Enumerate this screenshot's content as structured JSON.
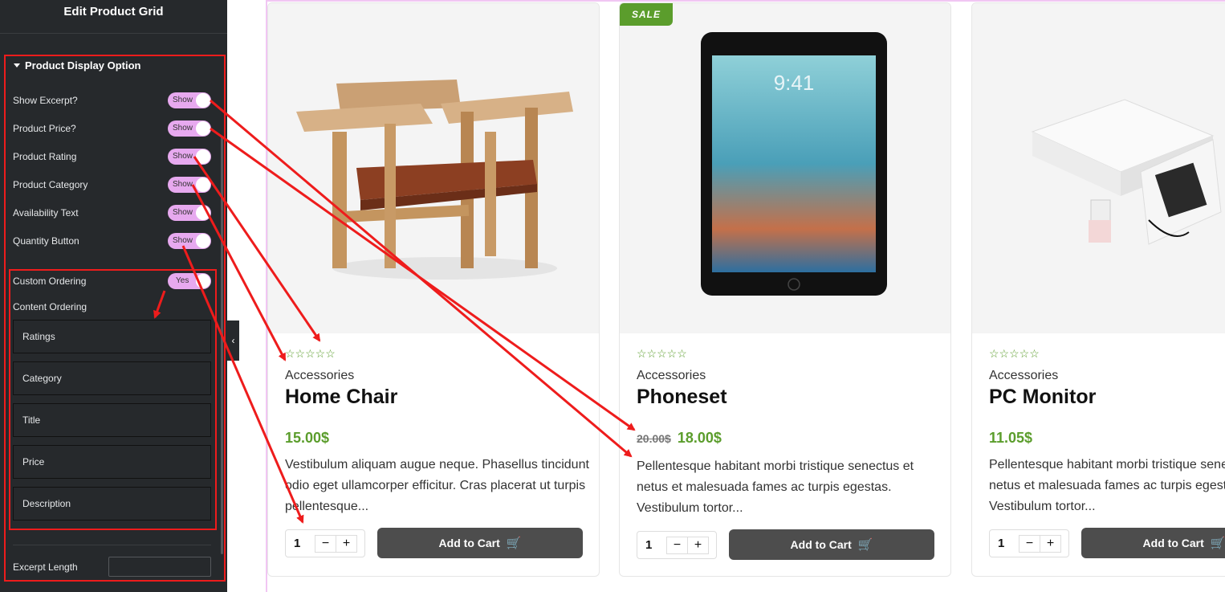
{
  "panel": {
    "title": "Edit Product Grid",
    "section_title": "Product Display Option",
    "options": [
      {
        "label": "Show Excerpt?",
        "toggle": "Show"
      },
      {
        "label": "Product Price?",
        "toggle": "Show"
      },
      {
        "label": "Product Rating",
        "toggle": "Show"
      },
      {
        "label": "Product Category",
        "toggle": "Show"
      },
      {
        "label": "Availability Text",
        "toggle": "Show"
      },
      {
        "label": "Quantity Button",
        "toggle": "Show"
      }
    ],
    "custom_ordering": {
      "label": "Custom Ordering",
      "toggle": "Yes"
    },
    "content_ordering_label": "Content Ordering",
    "ordering_items": [
      "Ratings",
      "Category",
      "Title",
      "Price",
      "Description"
    ],
    "excerpt_length_label": "Excerpt Length",
    "accent_color": "#e7a9ef"
  },
  "products": [
    {
      "category": "Accessories",
      "title": "Home Chair",
      "price": "15.00$",
      "description": "Vestibulum aliquam augue neque. Phasellus tincidunt odio eget ullamcorper efficitur. Cras placerat ut turpis pellentesque...",
      "quantity": "1",
      "cart_label": "Add to Cart"
    },
    {
      "badge": "SALE",
      "category": "Accessories",
      "title": "Phoneset",
      "old_price": "20.00$",
      "price": "18.00$",
      "description": "Pellentesque habitant morbi tristique senectus et netus et malesuada fames ac turpis egestas. Vestibulum tortor...",
      "quantity": "1",
      "cart_label": "Add to Cart",
      "screen_time": "9:41"
    },
    {
      "category": "Accessories",
      "title": "PC Monitor",
      "price": "11.05$",
      "description": "Pellentesque habitant morbi tristique senectus et netus et malesuada fames ac turpis egestas. Vestibulum tortor...",
      "quantity": "1",
      "cart_label": "Add to Cart"
    }
  ],
  "colors": {
    "price_green": "#5b9d2c",
    "annotation_red": "#ee1c1c",
    "panel_bg": "#26292c",
    "cart_button": "#4d4d4d"
  }
}
